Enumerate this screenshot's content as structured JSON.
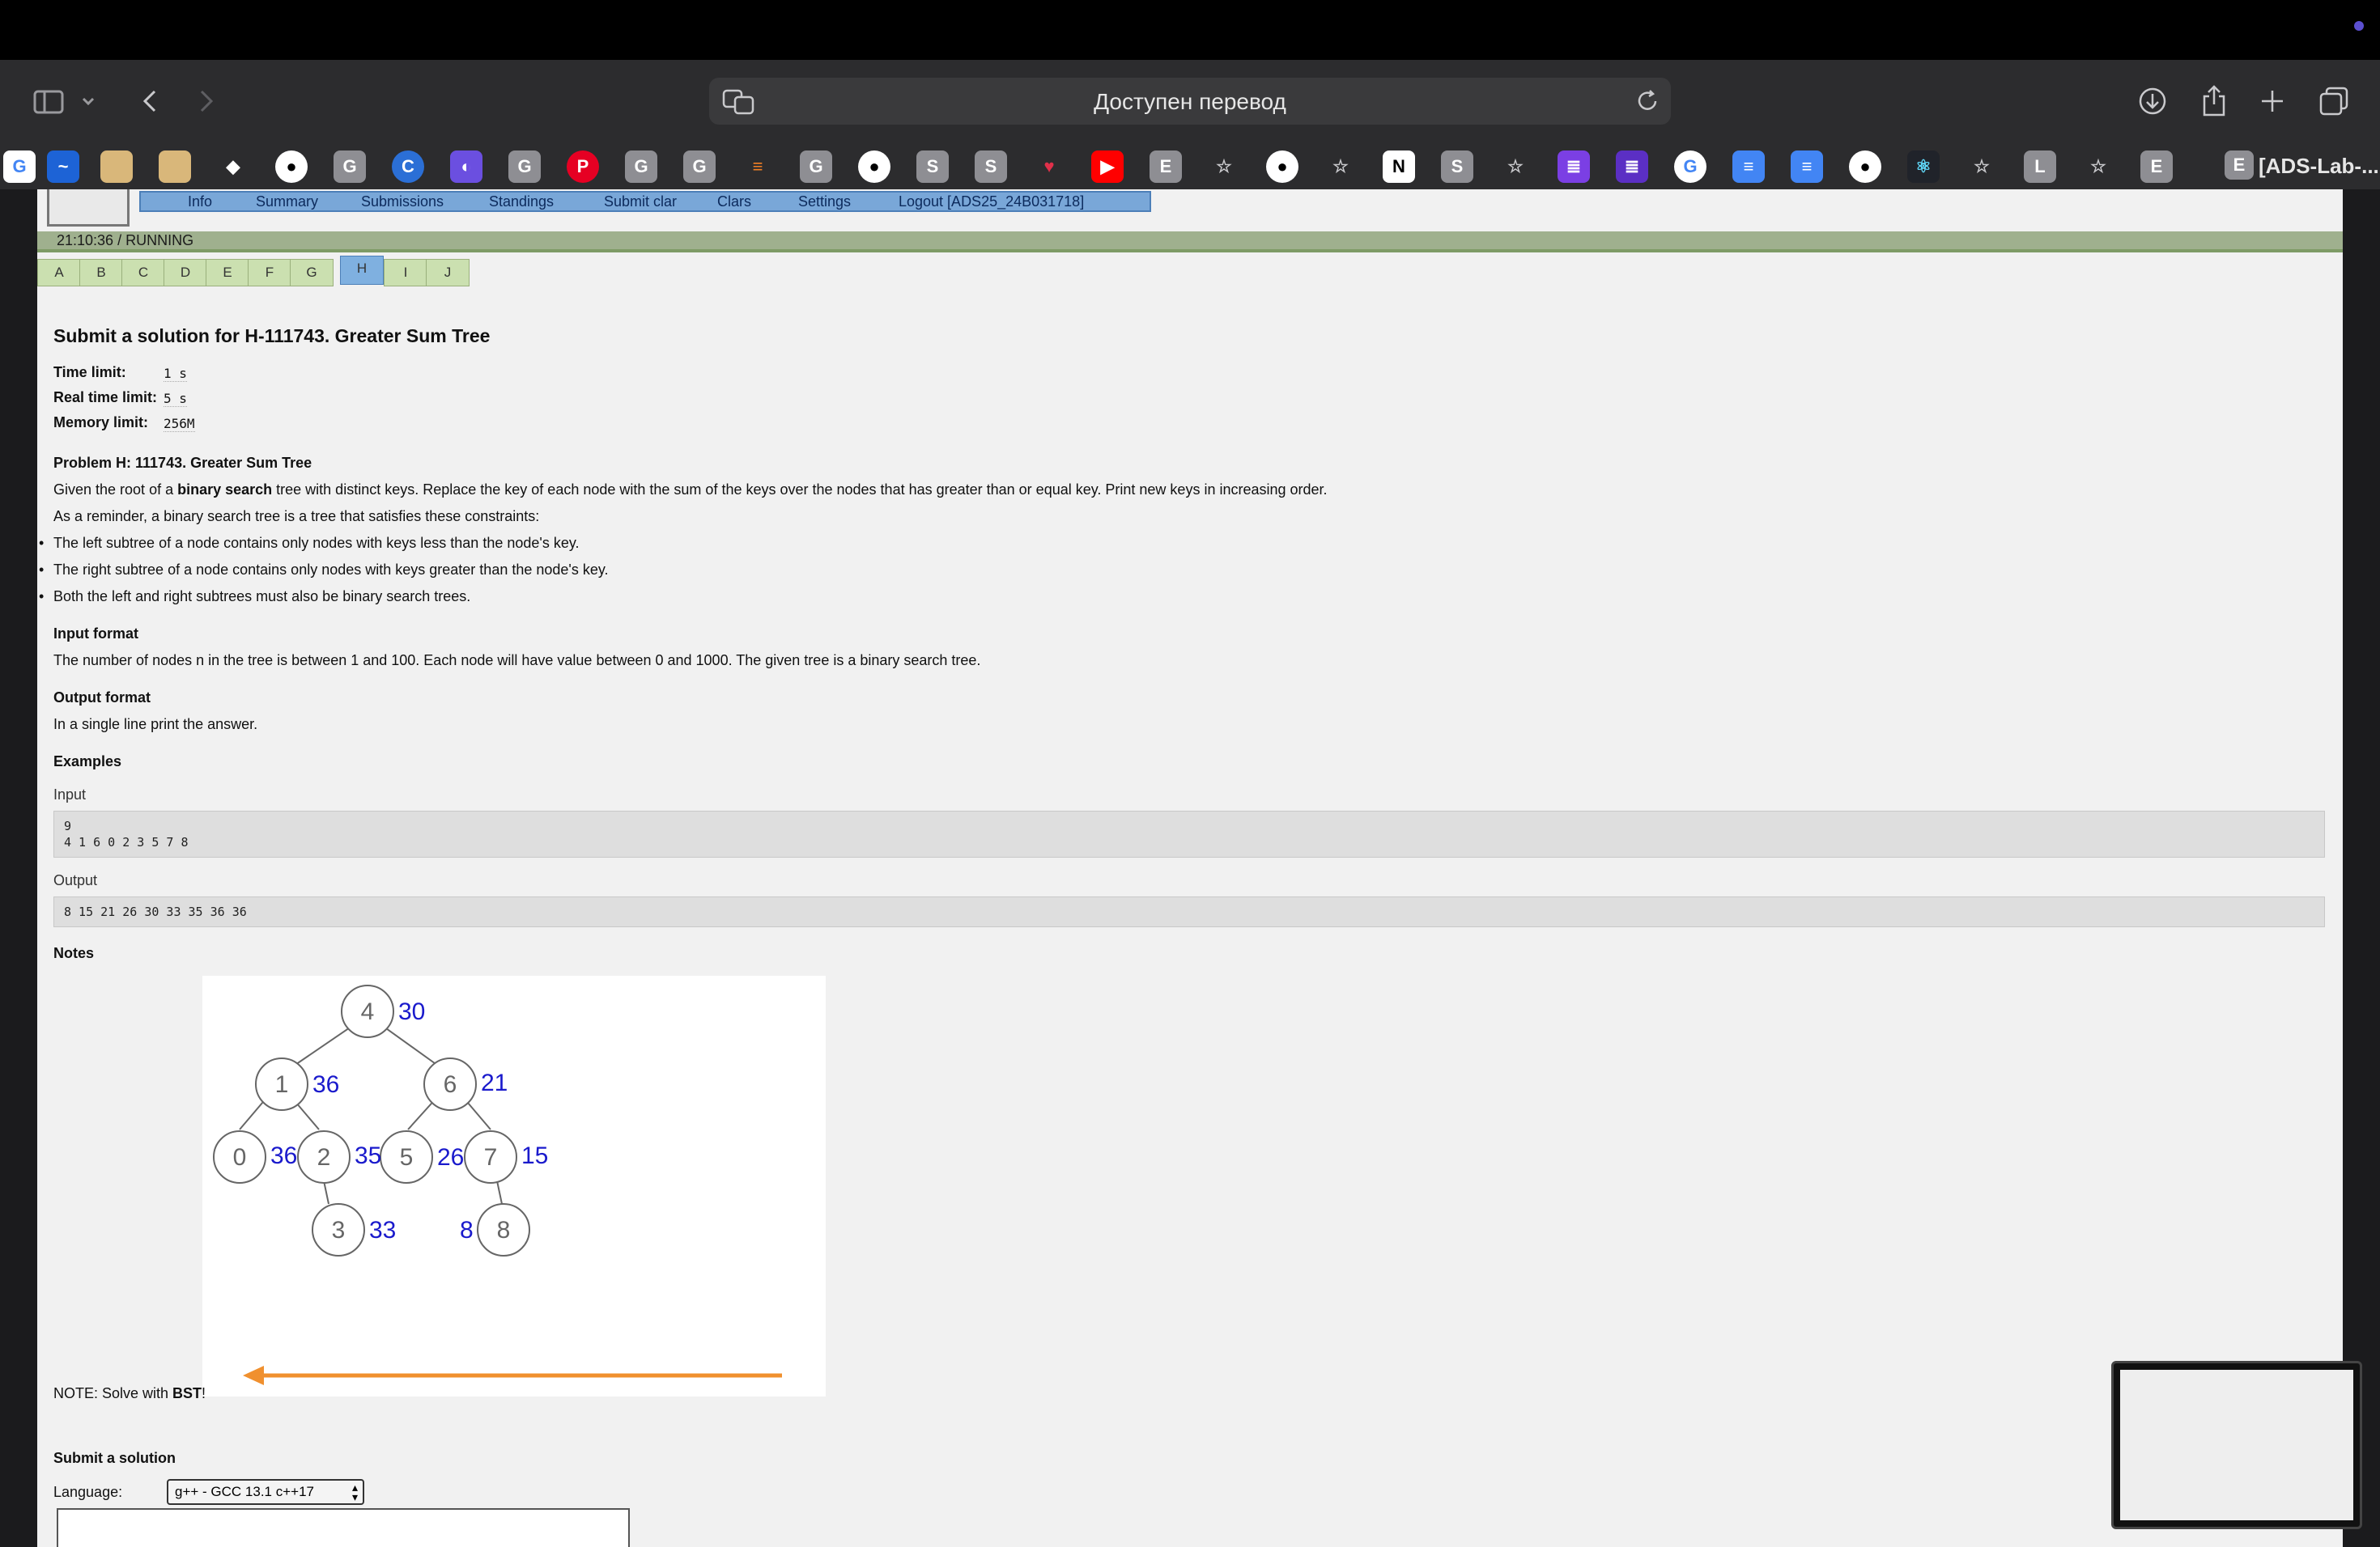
{
  "browser": {
    "address_text": "Доступен перевод",
    "last_tab_title": "[ADS-Lab-...",
    "last_tab_badge": "E"
  },
  "favorites": [
    "G",
    "S",
    "G",
    "G",
    "G",
    "G",
    "G",
    "S",
    "S",
    "E",
    "N",
    "S",
    "L",
    "E"
  ],
  "nav": {
    "items": [
      "Info",
      "Summary",
      "Submissions",
      "Standings",
      "Submit clar",
      "Clars",
      "Settings",
      "Logout [ADS25_24B031718]"
    ]
  },
  "status": "21:10:36 / RUNNING",
  "tabs": [
    "A",
    "B",
    "C",
    "D",
    "E",
    "F",
    "G",
    "H",
    "I",
    "J"
  ],
  "active_tab": "H",
  "problem": {
    "heading": "Submit a solution for H-111743. Greater Sum Tree",
    "limits": [
      {
        "label": "Time limit:",
        "value": "1 s"
      },
      {
        "label": "Real time limit:",
        "value": "5 s"
      },
      {
        "label": "Memory limit:",
        "value": "256M"
      }
    ],
    "title": "Problem H: 111743. Greater Sum Tree",
    "statement_pre": "Given the root of a ",
    "statement_bold": "binary search",
    "statement_post": " tree with distinct keys. Replace the key of each node with the sum of the keys over the nodes that has greater than or equal key. Print new keys in increasing order.",
    "reminder": "As a reminder, a binary search tree is a tree that satisfies these constraints:",
    "bullets": [
      "The left subtree of a node contains only nodes with keys less than the node's key.",
      "The right subtree of a node contains only nodes with keys greater than the node's key.",
      "Both the left and right subtrees must also be binary search trees."
    ],
    "input_format_title": "Input format",
    "input_format": "The number of nodes n in the tree is between 1 and 100. Each node will have value between 0 and 1000. The given tree is a binary search tree.",
    "output_format_title": "Output format",
    "output_format": "In a single line print the answer.",
    "examples_title": "Examples",
    "input_label": "Input",
    "input_line1": "9",
    "input_line2": "4 1 6 0 2 3 5 7 8",
    "output_label": "Output",
    "output_text": "8 15 21 26 30 33 35 36 36",
    "notes_title": "Notes",
    "note_pre": "NOTE: Solve with ",
    "note_bold": "BST",
    "note_post": "!"
  },
  "tree_nodes": [
    {
      "key": "4",
      "sum": "30"
    },
    {
      "key": "1",
      "sum": "36"
    },
    {
      "key": "6",
      "sum": "21"
    },
    {
      "key": "0",
      "sum": "36"
    },
    {
      "key": "2",
      "sum": "35"
    },
    {
      "key": "5",
      "sum": "26"
    },
    {
      "key": "7",
      "sum": "15"
    },
    {
      "key": "3",
      "sum": "33"
    },
    {
      "key": "8",
      "sum": "8"
    }
  ],
  "submit": {
    "title": "Submit a solution",
    "language_label": "Language:",
    "language_value": "g++ - GCC 13.1 c++17"
  },
  "colors": {
    "navbar": "#79a7d8",
    "tab": "#cbe0b0",
    "sum_blue": "#1a1acc",
    "arrow_orange": "#f0902e"
  }
}
